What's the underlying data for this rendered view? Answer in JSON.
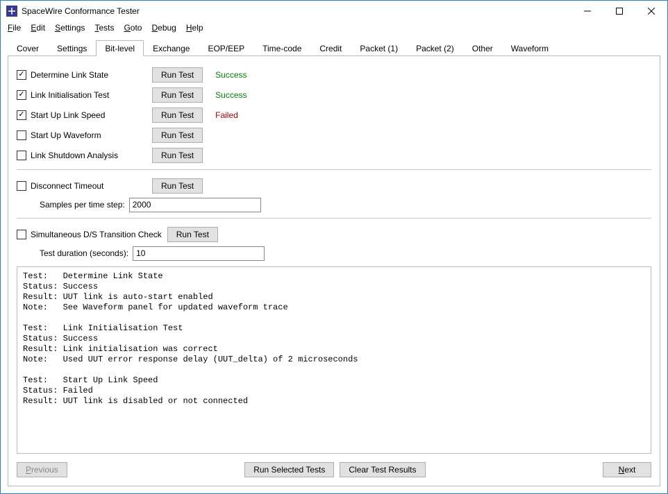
{
  "window": {
    "title": "SpaceWire Conformance Tester"
  },
  "menu": {
    "file": "File",
    "edit": "Edit",
    "settings": "Settings",
    "tests": "Tests",
    "goto": "Goto",
    "debug": "Debug",
    "help": "Help"
  },
  "tabs": {
    "cover": "Cover",
    "settings": "Settings",
    "bitlevel": "Bit-level",
    "exchange": "Exchange",
    "eopeep": "EOP/EEP",
    "timecode": "Time-code",
    "credit": "Credit",
    "packet1": "Packet (1)",
    "packet2": "Packet (2)",
    "other": "Other",
    "waveform": "Waveform"
  },
  "tests": {
    "run_label": "Run Test",
    "t1": {
      "label": "Determine Link State",
      "status": "Success"
    },
    "t2": {
      "label": "Link Initialisation Test",
      "status": "Success"
    },
    "t3": {
      "label": "Start Up Link Speed",
      "status": "Failed"
    },
    "t4": {
      "label": "Start Up Waveform"
    },
    "t5": {
      "label": "Link Shutdown Analysis"
    },
    "t6": {
      "label": "Disconnect Timeout"
    },
    "t7": {
      "label": "Simultaneous D/S Transition Check"
    }
  },
  "inputs": {
    "samples_label": "Samples per time step:",
    "samples_value": "2000",
    "duration_label": "Test duration (seconds):",
    "duration_value": "10"
  },
  "results_text": "Test:   Determine Link State\nStatus: Success\nResult: UUT link is auto-start enabled\nNote:   See Waveform panel for updated waveform trace\n\nTest:   Link Initialisation Test\nStatus: Success\nResult: Link initialisation was correct\nNote:   Used UUT error response delay (UUT_delta) of 2 microseconds\n\nTest:   Start Up Link Speed\nStatus: Failed\nResult: UUT link is disabled or not connected",
  "buttons": {
    "previous": "Previous",
    "run_selected": "Run Selected Tests",
    "clear": "Clear Test Results",
    "next": "Next"
  }
}
